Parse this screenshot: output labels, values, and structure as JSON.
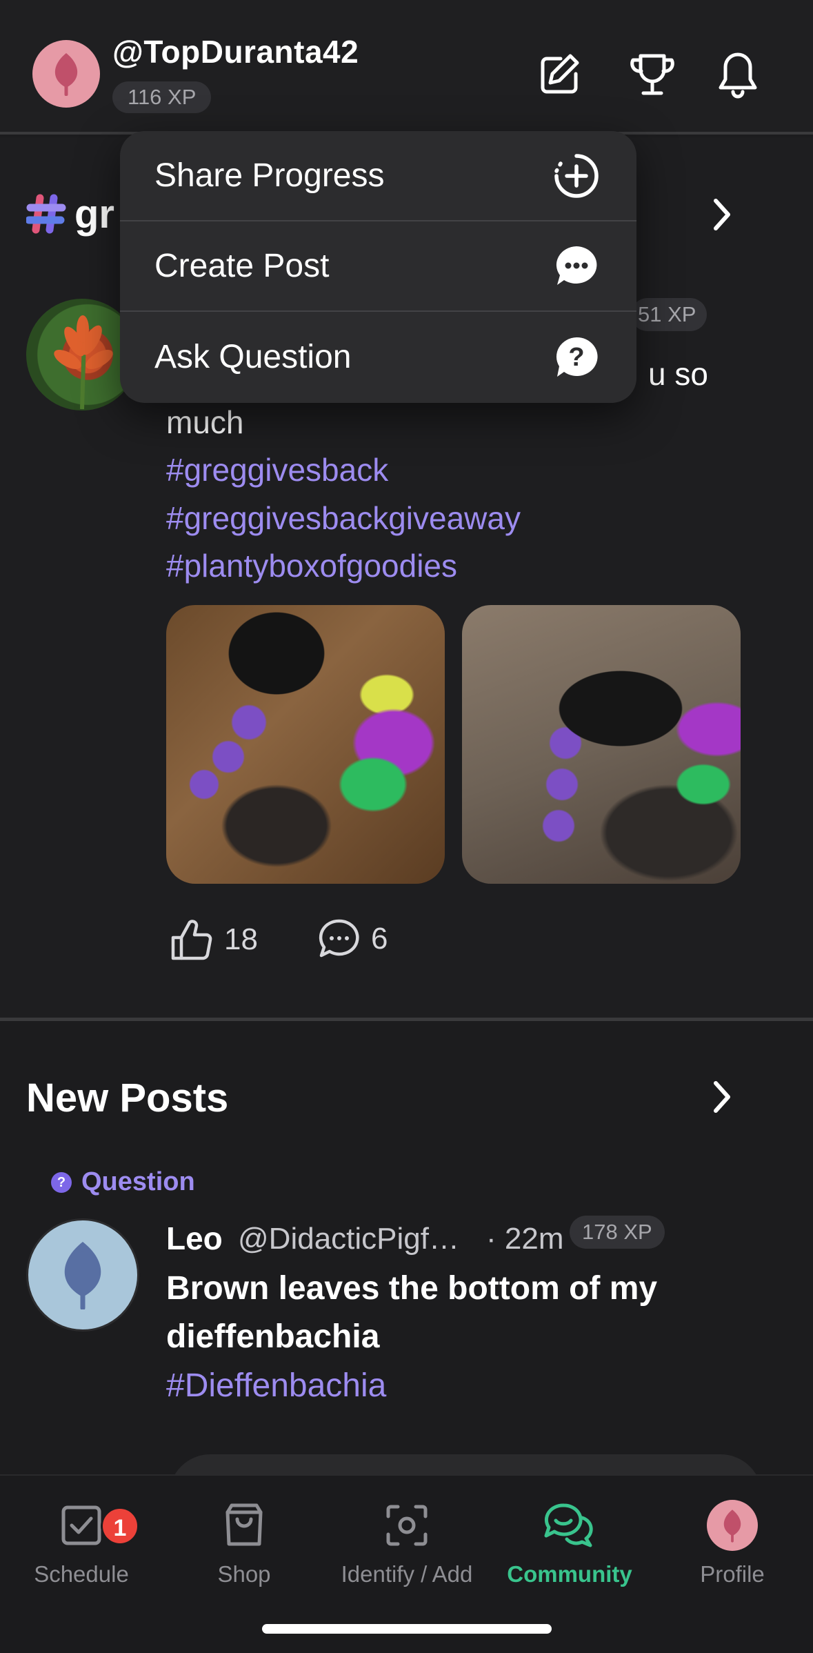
{
  "header": {
    "username": "@TopDuranta42",
    "xp": "116 XP",
    "icons": [
      "compose-icon",
      "trophy-icon",
      "bell-icon"
    ]
  },
  "menu": {
    "items": [
      {
        "label": "Share Progress",
        "icon": "add-circle-icon"
      },
      {
        "label": "Create Post",
        "icon": "chat-bubble-icon"
      },
      {
        "label": "Ask Question",
        "icon": "question-icon"
      }
    ]
  },
  "featured": {
    "channel_visible": "gr",
    "xp_visible": "51 XP",
    "text_line1_visible": "u so",
    "text_line2": "much",
    "hashtags": [
      "#greggivesback",
      "#greggivesbackgiveaway",
      "#plantyboxofgoodies"
    ],
    "likes": "18",
    "comments": "6"
  },
  "new_posts": {
    "title": "New Posts",
    "badge": "Question",
    "post": {
      "name": "Leo",
      "handle": "@DidacticPigf…",
      "time": "· 22m",
      "xp": "178 XP",
      "title": "Brown leaves the bottom of my dieffenbachia",
      "hashtag": "#Dieffenbachia"
    }
  },
  "tabs": [
    {
      "label": "Schedule",
      "icon": "checkbox-icon",
      "badge": "1"
    },
    {
      "label": "Shop",
      "icon": "bag-icon"
    },
    {
      "label": "Identify / Add",
      "icon": "scan-icon"
    },
    {
      "label": "Community",
      "icon": "chat-icon",
      "active": true
    },
    {
      "label": "Profile",
      "icon": "avatar-icon"
    }
  ],
  "colors": {
    "accent_green": "#39c48d",
    "hashtag_purple": "#9d8cf0",
    "badge_red": "#ec4139",
    "avatar_pink": "#e69aa6",
    "avatar_blue": "#a9c6da"
  }
}
